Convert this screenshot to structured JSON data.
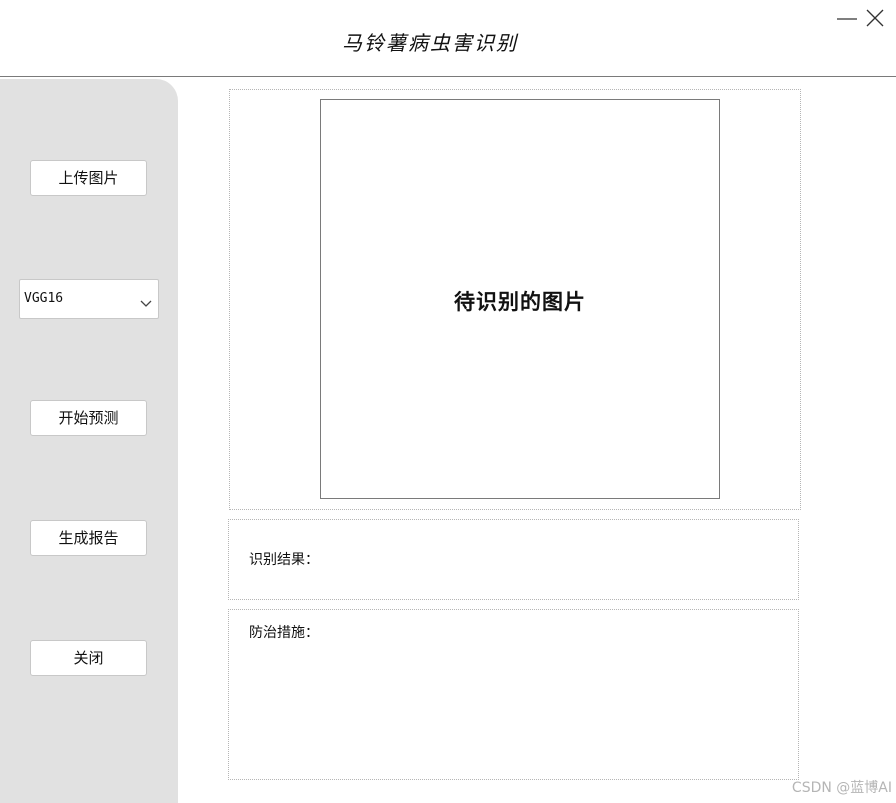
{
  "window": {
    "title": "马铃薯病虫害识别",
    "minimize_icon": "minimize-icon",
    "close_icon": "close-icon"
  },
  "sidebar": {
    "upload_label": "上传图片",
    "model_select": {
      "value": "VGG16",
      "icon": "chevron-down-icon"
    },
    "predict_label": "开始预测",
    "report_label": "生成报告",
    "close_label": "关闭"
  },
  "main": {
    "image_placeholder": "待识别的图片",
    "result_label": "识别结果：",
    "measures_label": "防治措施："
  },
  "watermark": "CSDN @蓝博AI"
}
